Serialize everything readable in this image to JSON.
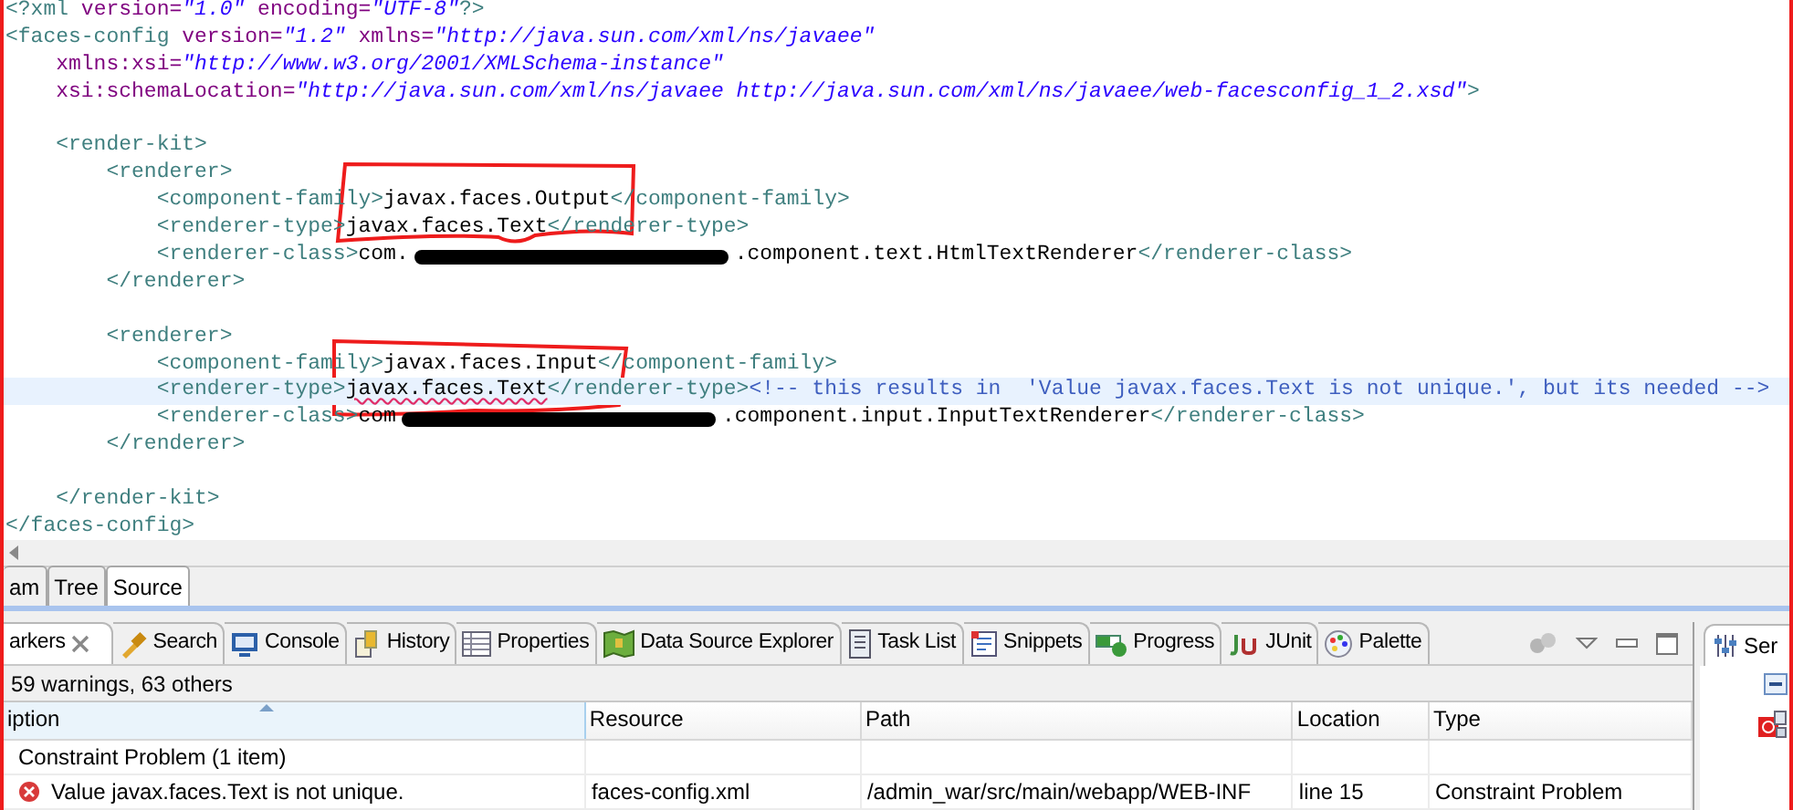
{
  "editor": {
    "lines": [
      {
        "kind": "code",
        "current": false,
        "tokens": [
          {
            "kind": "tag",
            "text": "<?xml "
          },
          {
            "kind": "attr",
            "text": "version="
          },
          {
            "kind": "value",
            "text": "\"1.0\""
          },
          {
            "kind": "attr",
            "text": " encoding="
          },
          {
            "kind": "value",
            "text": "\"UTF-8\""
          },
          {
            "kind": "tag",
            "text": "?>"
          }
        ]
      },
      {
        "kind": "code",
        "current": false,
        "tokens": [
          {
            "kind": "tag",
            "text": "<faces-config "
          },
          {
            "kind": "attr",
            "text": "version="
          },
          {
            "kind": "value",
            "text": "\"1.2\""
          },
          {
            "kind": "attr",
            "text": " xmlns="
          },
          {
            "kind": "value",
            "text": "\"http://java.sun.com/xml/ns/javaee\""
          }
        ]
      },
      {
        "kind": "code",
        "current": false,
        "tokens": [
          {
            "kind": "attr",
            "text": "    xmlns:xsi="
          },
          {
            "kind": "value",
            "text": "\"http://www.w3.org/2001/XMLSchema-instance\""
          }
        ]
      },
      {
        "kind": "code",
        "current": false,
        "tokens": [
          {
            "kind": "attr",
            "text": "    xsi:schemaLocation="
          },
          {
            "kind": "value",
            "text": "\"http://java.sun.com/xml/ns/javaee http://java.sun.com/xml/ns/javaee/web-facesconfig_1_2.xsd\""
          },
          {
            "kind": "tag",
            "text": ">"
          }
        ]
      },
      {
        "kind": "blank"
      },
      {
        "kind": "code",
        "current": false,
        "tokens": [
          {
            "kind": "tag",
            "text": "    <render-kit>"
          }
        ]
      },
      {
        "kind": "code",
        "current": false,
        "tokens": [
          {
            "kind": "tag",
            "text": "        <renderer>"
          }
        ]
      },
      {
        "kind": "code",
        "current": false,
        "tokens": [
          {
            "kind": "tag",
            "text": "            <component-family>"
          },
          {
            "kind": "text",
            "text": "javax.faces.Output"
          },
          {
            "kind": "tag",
            "text": "</component-family>"
          }
        ]
      },
      {
        "kind": "code",
        "current": false,
        "tokens": [
          {
            "kind": "tag",
            "text": "            <renderer-type>"
          },
          {
            "kind": "text",
            "text": "javax.faces.Text"
          },
          {
            "kind": "tag",
            "text": "</renderer-type>"
          }
        ]
      },
      {
        "kind": "code",
        "current": false,
        "tokens": [
          {
            "kind": "tag",
            "text": "            <renderer-class>"
          },
          {
            "kind": "text",
            "text": "com."
          },
          {
            "kind": "redaction"
          },
          {
            "kind": "text",
            "text": ".component.text.HtmlTextRenderer"
          },
          {
            "kind": "tag",
            "text": "</renderer-class>"
          }
        ]
      },
      {
        "kind": "code",
        "current": false,
        "tokens": [
          {
            "kind": "tag",
            "text": "        </renderer>"
          }
        ]
      },
      {
        "kind": "blank"
      },
      {
        "kind": "code",
        "current": false,
        "tokens": [
          {
            "kind": "tag",
            "text": "        <renderer>"
          }
        ]
      },
      {
        "kind": "code",
        "current": false,
        "tokens": [
          {
            "kind": "tag",
            "text": "            <component-family>"
          },
          {
            "kind": "text",
            "text": "javax.faces.Input"
          },
          {
            "kind": "tag",
            "text": "</component-family>"
          }
        ]
      },
      {
        "kind": "code",
        "current": true,
        "tokens": [
          {
            "kind": "tag",
            "text": "            <renderer-type>"
          },
          {
            "kind": "text",
            "text": "javax.faces.Text",
            "error": true
          },
          {
            "kind": "tag",
            "text": "</renderer-type>"
          },
          {
            "kind": "comment",
            "text": "<!-- this results in  'Value javax.faces.Text is not unique.', but its needed -->"
          }
        ]
      },
      {
        "kind": "code",
        "current": false,
        "tokens": [
          {
            "kind": "tag",
            "text": "            <renderer-class>"
          },
          {
            "kind": "text",
            "text": "com"
          },
          {
            "kind": "redaction"
          },
          {
            "kind": "text",
            "text": ".component.input.InputTextRenderer"
          },
          {
            "kind": "tag",
            "text": "</renderer-class>"
          }
        ]
      },
      {
        "kind": "code",
        "current": false,
        "tokens": [
          {
            "kind": "tag",
            "text": "        </renderer>"
          }
        ]
      },
      {
        "kind": "blank"
      },
      {
        "kind": "code",
        "current": false,
        "tokens": [
          {
            "kind": "tag",
            "text": "    </render-kit>"
          }
        ]
      },
      {
        "kind": "code",
        "current": false,
        "tokens": [
          {
            "kind": "tag",
            "text": "</faces-config>"
          }
        ]
      }
    ]
  },
  "editor_tabs": [
    {
      "label": "am",
      "selected": false
    },
    {
      "label": "Tree",
      "selected": false
    },
    {
      "label": "Source",
      "selected": true
    }
  ],
  "view_tabs": [
    {
      "label": "arkers",
      "selected": true
    },
    {
      "label": "Search",
      "selected": false
    },
    {
      "label": "Console",
      "selected": false
    },
    {
      "label": "History",
      "selected": false
    },
    {
      "label": "Properties",
      "selected": false
    },
    {
      "label": "Data Source Explorer",
      "selected": false
    },
    {
      "label": "Task List",
      "selected": false
    },
    {
      "label": "Snippets",
      "selected": false
    },
    {
      "label": "Progress",
      "selected": false
    },
    {
      "label": "JUnit",
      "selected": false
    },
    {
      "label": "Palette",
      "selected": false
    }
  ],
  "status": "59 warnings, 63 others",
  "table": {
    "columns": [
      {
        "label": "iption",
        "sorted": true
      },
      {
        "label": "Resource",
        "sorted": false
      },
      {
        "label": "Path",
        "sorted": false
      },
      {
        "label": "Location",
        "sorted": false
      },
      {
        "label": "Type",
        "sorted": false
      }
    ],
    "rows": [
      {
        "kind": "group",
        "cells": [
          "Constraint Problem (1 item)"
        ]
      },
      {
        "kind": "error",
        "cells": [
          "Value javax.faces.Text is not unique.",
          "faces-config.xml",
          "/admin_war/src/main/webapp/WEB-INF",
          "line 15",
          "Constraint Problem"
        ]
      }
    ]
  },
  "side_panel": {
    "tab": "Ser"
  }
}
